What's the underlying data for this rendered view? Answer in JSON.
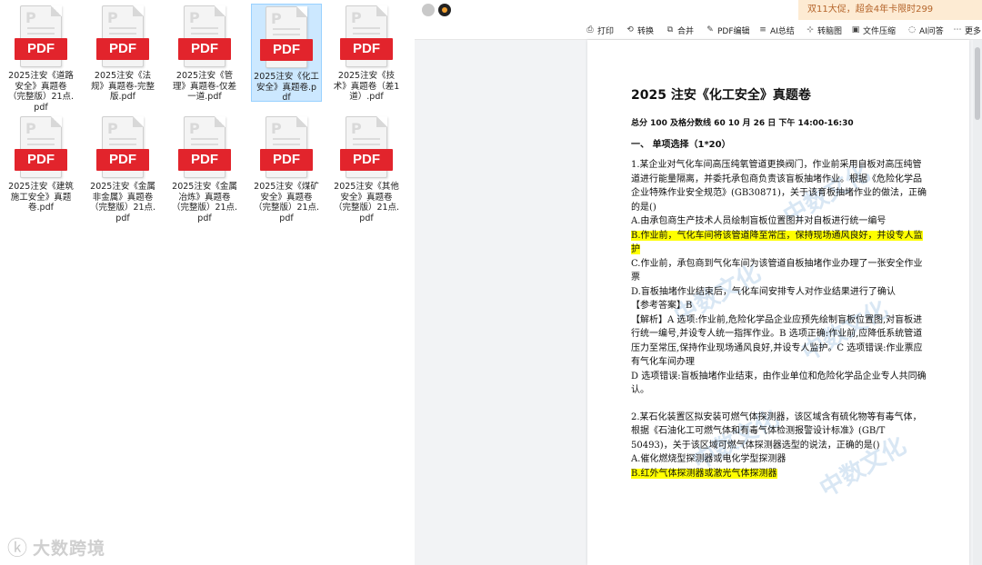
{
  "files": [
    {
      "name": "2025注安《道路安全》真题卷（完整版）21点.pdf",
      "selected": false
    },
    {
      "name": "2025注安《法规》真题卷-完整版.pdf",
      "selected": false
    },
    {
      "name": "2025注安《管理》真题卷-仅差一道.pdf",
      "selected": false
    },
    {
      "name": "2025注安《化工安全》真题卷.pdf",
      "selected": true
    },
    {
      "name": "2025注安《技术》真题卷（差1道）.pdf",
      "selected": false
    },
    {
      "name": "2025注安《建筑施工安全》真题卷.pdf",
      "selected": false
    },
    {
      "name": "2025注安《金属非金属》真题卷（完整版）21点.pdf",
      "selected": false
    },
    {
      "name": "2025注安《金属冶炼》真题卷（完整版）21点.pdf",
      "selected": false
    },
    {
      "name": "2025注安《煤矿安全》真题卷（完整版）21点.pdf",
      "selected": false
    },
    {
      "name": "2025注安《其他安全》真题卷（完整版）21点.pdf",
      "selected": false
    }
  ],
  "icon_badge": "PDF",
  "logo_text": "大数跨境",
  "promo_text": "双11大促，超会4年卡限时299",
  "toolbar": [
    {
      "label": "打印",
      "icon": "printer-icon",
      "glyph": "⎙"
    },
    {
      "label": "转换",
      "icon": "convert-icon",
      "glyph": "⟲"
    },
    {
      "label": "合并",
      "icon": "merge-icon",
      "glyph": "⧉"
    },
    {
      "label": "PDF编辑",
      "icon": "edit-icon",
      "glyph": "✎"
    },
    {
      "label": "AI总结",
      "icon": "ai-summary-icon",
      "glyph": "≡"
    },
    {
      "label": "转脑图",
      "icon": "mindmap-icon",
      "glyph": "⊹"
    },
    {
      "label": "文件压缩",
      "icon": "compress-icon",
      "glyph": "▣"
    },
    {
      "label": "AI问答",
      "icon": "ai-qa-icon",
      "glyph": "◌"
    },
    {
      "label": "更多",
      "icon": "more-icon",
      "glyph": "⋯"
    }
  ],
  "document": {
    "title": "2025 注安《化工安全》真题卷",
    "meta": "总分 100  及格分数线 60 10 月 26 日 下午 14:00-16:30",
    "section": "一、   单项选择（1*20）",
    "q1_stem": "1.某企业对气化车间高压纯氧管道更换阀门，作业前采用自板对高压纯管道进行能量隔离，并委托承包商负责该盲板抽堵作业。根据《危险化学品企业特殊作业安全规范》(GB30871)，关于该育板抽堵作业的做法，正确的是()",
    "q1_a": "A.由承包商生产技术人员绘制盲板位置图并对自板进行统一编号",
    "q1_b": "B.作业前，气化车间将该管道降至常压，保持现场通风良好，并设专人监护",
    "q1_c": "C.作业前，承包商到气化车间为该管道自板抽堵作业办理了一张安全作业票",
    "q1_d": "D.盲板抽堵作业结束后，气化车间安排专人对作业结果进行了确认",
    "q1_answer": "【参考答案】B",
    "q1_analysis": "【解析】A 选项:作业前,危险化学品企业应预先绘制盲板位置图,对盲板进行统一编号,并设专人统一指挥作业。B 选项正确:作业前,应降低系统管道压力至常压,保持作业现场通风良好,并设专人监护。C 选项错误:作业票应有气化车间办理",
    "q1_analysis2": "D 选项错误:盲板抽堵作业结束，由作业单位和危险化学品企业专人共同确认。",
    "q2_stem": "2.某石化装置区拟安装可燃气体探测器，该区域含有硫化物等有毒气体，根据《石油化工可燃气体和有毒气体检测报警设计标准》(GB/T 50493)，关于该区域可燃气体探测器选型的说法，正确的是()",
    "q2_a": "A.催化燃烧型探测器或电化学型探测器",
    "q2_b": "B.红外气体探测器或激光气体探测器"
  }
}
